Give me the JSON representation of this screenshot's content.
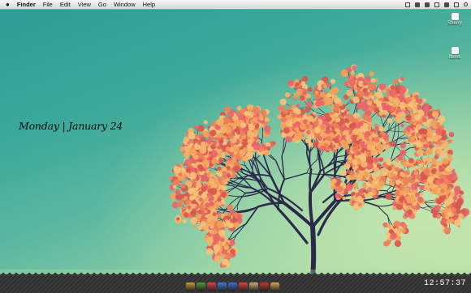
{
  "menubar": {
    "apple_icon": "apple-icon",
    "app_name": "Finder",
    "items": [
      "File",
      "Edit",
      "View",
      "Go",
      "Window",
      "Help"
    ],
    "status_icons": [
      "sync-icon",
      "app-icon",
      "volume-icon",
      "battery-icon",
      "wifi-icon",
      "user-icon",
      "search-icon"
    ]
  },
  "desktop_icons": [
    {
      "label": "Sherry",
      "icon": "home-folder-icon"
    },
    {
      "label": "Items",
      "icon": "stack-icon"
    }
  ],
  "date_widget": {
    "text": "Monday | January 24"
  },
  "dock": {
    "apps": [
      {
        "icon": "finder-icon",
        "color": "#c49a3a",
        "running": true
      },
      {
        "icon": "maps-icon",
        "color": "#4a9a3a",
        "running": false
      },
      {
        "icon": "photos-icon",
        "color": "#d8444a",
        "running": false
      },
      {
        "icon": "app-store-icon",
        "color": "#3c7fd8",
        "running": false
      },
      {
        "icon": "mail-icon",
        "color": "#3d6fcf",
        "running": false
      },
      {
        "icon": "news-icon",
        "color": "#d8463c",
        "running": false
      },
      {
        "icon": "folder-icon",
        "color": "#c2b070",
        "running": false
      },
      {
        "icon": "calendar-icon",
        "color": "#c0392b",
        "running": false
      },
      {
        "icon": "trash-icon",
        "color": "#d6a84a",
        "running": false
      }
    ]
  },
  "clock": {
    "time": "12:57:37"
  }
}
